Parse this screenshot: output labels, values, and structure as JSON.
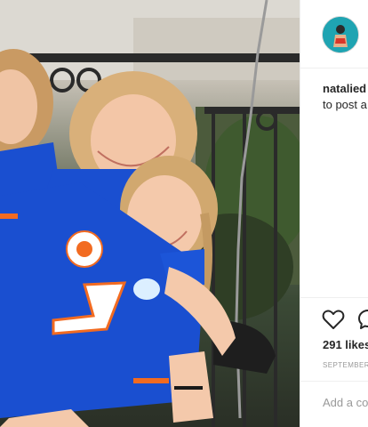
{
  "post": {
    "username": "natalied",
    "caption_fragment": "to post a",
    "likes": "291 likes",
    "date": "SEPTEMBER",
    "add_comment_placeholder": "Add a co"
  },
  "icons": {
    "like": "heart-icon",
    "comment": "comment-icon",
    "avatar": "profile-avatar"
  },
  "colors": {
    "jersey_blue": "#1a4fd0",
    "jersey_orange": "#f26b21",
    "text_primary": "#262626",
    "text_secondary": "#999999",
    "divider": "#efefef"
  }
}
